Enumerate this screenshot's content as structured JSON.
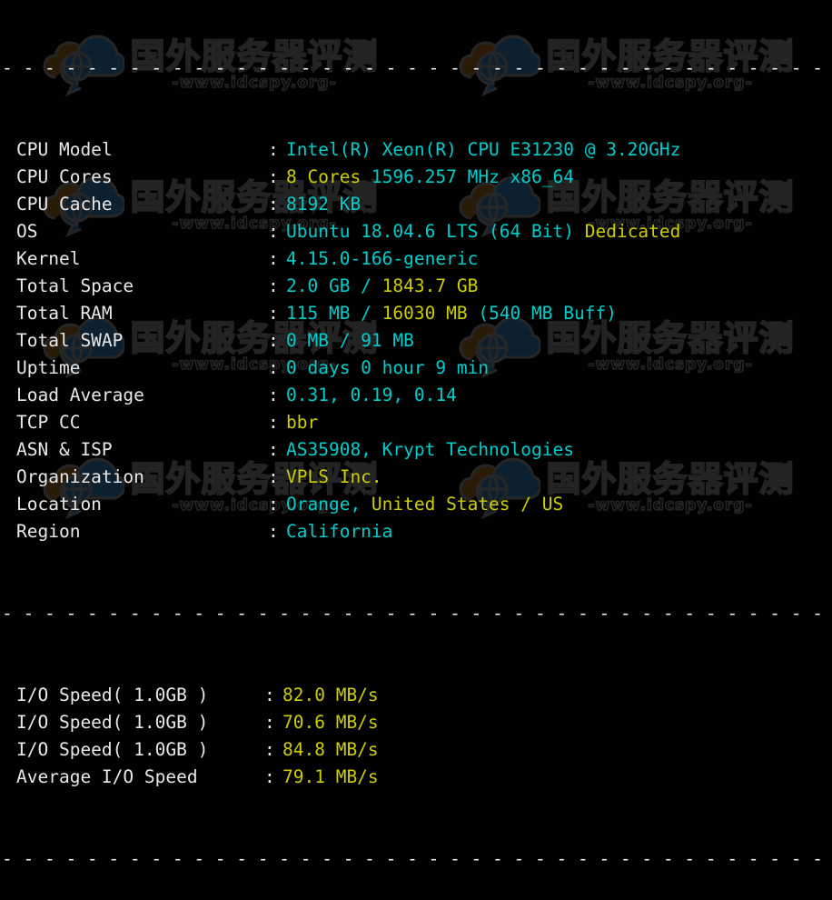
{
  "terminal": {
    "separator_char": "-",
    "colors": {
      "label": "#e8e8e8",
      "cyan": "#00cdcd",
      "yellow": "#cdcd00",
      "background": "#010101"
    },
    "colon": ":",
    "top_rule": "-------------------------------------------------------------",
    "middle_rule": "-------------------------------------------------------------",
    "bottom_rule": "-------------------------------------------------------------",
    "system_rows": [
      {
        "label": "CPU Model",
        "segments": [
          {
            "text": "Intel(R) Xeon(R) CPU E31230 @ 3.20GHz",
            "color": "cyan"
          }
        ]
      },
      {
        "label": "CPU Cores",
        "segments": [
          {
            "text": "8 Cores",
            "color": "yellow"
          },
          {
            "text": " 1596.257 MHz x86_64",
            "color": "cyan"
          }
        ]
      },
      {
        "label": "CPU Cache",
        "segments": [
          {
            "text": "8192 KB",
            "color": "cyan"
          }
        ]
      },
      {
        "label": "OS",
        "segments": [
          {
            "text": "Ubuntu 18.04.6 LTS (64 Bit) ",
            "color": "cyan"
          },
          {
            "text": "Dedicated",
            "color": "yellow"
          }
        ]
      },
      {
        "label": "Kernel",
        "segments": [
          {
            "text": "4.15.0-166-generic",
            "color": "cyan"
          }
        ]
      },
      {
        "label": "Total Space",
        "segments": [
          {
            "text": "2.0 GB / ",
            "color": "cyan"
          },
          {
            "text": "1843.7 GB",
            "color": "yellow"
          }
        ]
      },
      {
        "label": "Total RAM",
        "segments": [
          {
            "text": "115 MB / ",
            "color": "cyan"
          },
          {
            "text": "16030 MB",
            "color": "yellow"
          },
          {
            "text": " (540 MB Buff)",
            "color": "cyan"
          }
        ]
      },
      {
        "label": "Total SWAP",
        "segments": [
          {
            "text": "0 MB / 91 MB",
            "color": "cyan"
          }
        ]
      },
      {
        "label": "Uptime",
        "segments": [
          {
            "text": "0 days 0 hour 9 min",
            "color": "cyan"
          }
        ]
      },
      {
        "label": "Load Average",
        "segments": [
          {
            "text": "0.31, 0.19, 0.14",
            "color": "cyan"
          }
        ]
      },
      {
        "label": "TCP CC",
        "segments": [
          {
            "text": "bbr",
            "color": "yellow"
          }
        ]
      },
      {
        "label": "ASN & ISP",
        "segments": [
          {
            "text": "AS35908, Krypt Technologies",
            "color": "cyan"
          }
        ]
      },
      {
        "label": "Organization",
        "segments": [
          {
            "text": "VPLS Inc.",
            "color": "yellow"
          }
        ]
      },
      {
        "label": "Location",
        "segments": [
          {
            "text": "Orange, ",
            "color": "cyan"
          },
          {
            "text": "United States / US",
            "color": "yellow"
          }
        ]
      },
      {
        "label": "Region",
        "segments": [
          {
            "text": "California",
            "color": "cyan"
          }
        ]
      }
    ],
    "io_rows": [
      {
        "label": "I/O Speed( 1.0GB )",
        "segments": [
          {
            "text": "82.0 MB/s",
            "color": "yellow"
          }
        ]
      },
      {
        "label": "I/O Speed( 1.0GB )",
        "segments": [
          {
            "text": "70.6 MB/s",
            "color": "yellow"
          }
        ]
      },
      {
        "label": "I/O Speed( 1.0GB )",
        "segments": [
          {
            "text": "84.8 MB/s",
            "color": "yellow"
          }
        ]
      },
      {
        "label": "Average I/O Speed",
        "segments": [
          {
            "text": "79.1 MB/s",
            "color": "yellow"
          }
        ]
      }
    ]
  },
  "watermark": {
    "chinese_text": "国外服务器评测",
    "url_text": "-www.idcspy.org-",
    "logo_name": "cloud-globe-logo"
  }
}
